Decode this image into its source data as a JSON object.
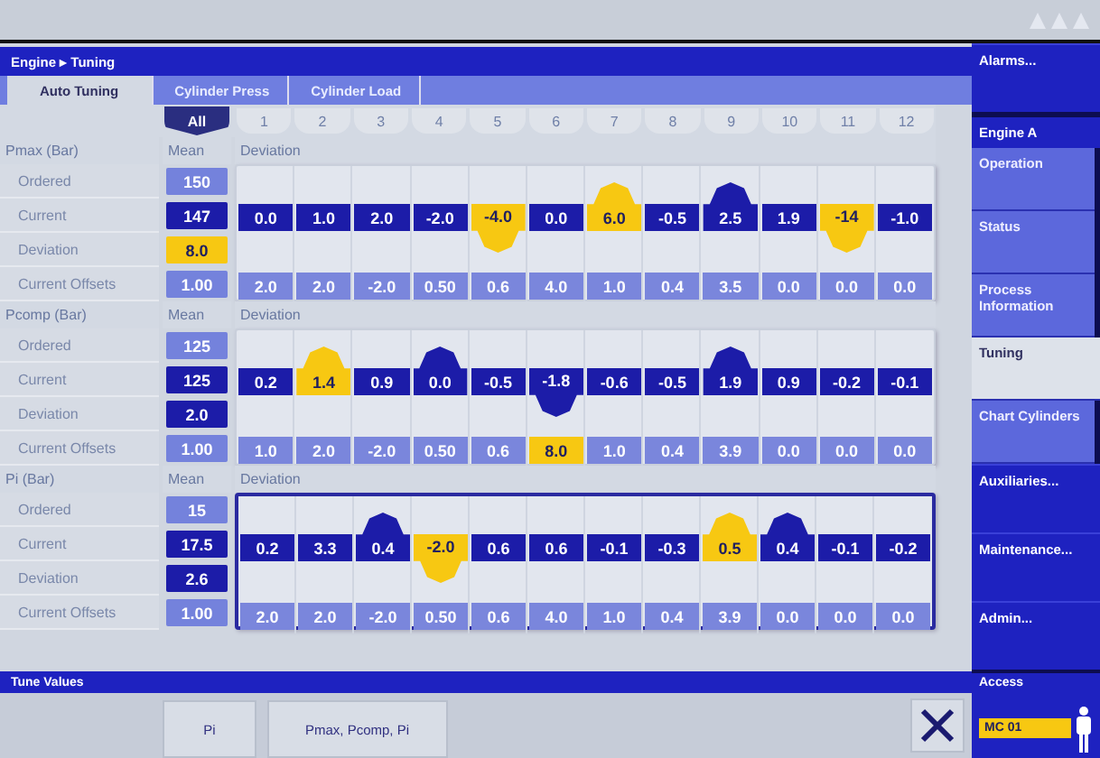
{
  "window": {
    "title": "Engine ▸ Tuning"
  },
  "tabs": [
    {
      "label": "Auto Tuning",
      "selected": true
    },
    {
      "label": "Cylinder Press",
      "selected": false
    },
    {
      "label": "Cylinder Load",
      "selected": false
    }
  ],
  "cylinders": [
    {
      "label": "All",
      "selected": true
    },
    {
      "label": "1",
      "selected": false
    },
    {
      "label": "2",
      "selected": false
    },
    {
      "label": "3",
      "selected": false
    },
    {
      "label": "4",
      "selected": false
    },
    {
      "label": "5",
      "selected": false
    },
    {
      "label": "6",
      "selected": false
    },
    {
      "label": "7",
      "selected": false
    },
    {
      "label": "8",
      "selected": false
    },
    {
      "label": "9",
      "selected": false
    },
    {
      "label": "10",
      "selected": false
    },
    {
      "label": "11",
      "selected": false
    },
    {
      "label": "12",
      "selected": false
    }
  ],
  "sections": [
    {
      "title": "Pmax (Bar)",
      "mean_heading": "Mean",
      "deviation_heading": "Deviation",
      "selected": false,
      "rows": [
        {
          "label": "Ordered",
          "kind": "ordered",
          "mean": "150",
          "warning": false
        },
        {
          "label": "Current",
          "kind": "current",
          "mean": "147",
          "warning": false
        },
        {
          "label": "Deviation",
          "kind": "deviation",
          "mean": "8.0",
          "warning": true
        },
        {
          "label": "Current Offsets",
          "kind": "offsets",
          "mean": "1.00",
          "warning": false
        }
      ],
      "current": [
        {
          "value": "0.0",
          "high": false,
          "low": false,
          "warning": false
        },
        {
          "value": "1.0",
          "high": false,
          "low": false,
          "warning": false
        },
        {
          "value": "2.0",
          "high": false,
          "low": false,
          "warning": false
        },
        {
          "value": "-2.0",
          "high": false,
          "low": false,
          "warning": false
        },
        {
          "value": "-4.0",
          "high": false,
          "low": true,
          "warning": true
        },
        {
          "value": "0.0",
          "high": false,
          "low": false,
          "warning": false
        },
        {
          "value": "6.0",
          "high": true,
          "low": false,
          "warning": true
        },
        {
          "value": "-0.5",
          "high": false,
          "low": false,
          "warning": false
        },
        {
          "value": "2.5",
          "high": true,
          "low": false,
          "warning": false
        },
        {
          "value": "1.9",
          "high": false,
          "low": false,
          "warning": false
        },
        {
          "value": "-14",
          "high": false,
          "low": true,
          "warning": true
        },
        {
          "value": "-1.0",
          "high": false,
          "low": false,
          "warning": false
        }
      ],
      "offsets": [
        {
          "value": "2.0",
          "warning": false
        },
        {
          "value": "2.0",
          "warning": false
        },
        {
          "value": "-2.0",
          "warning": false
        },
        {
          "value": "0.50",
          "warning": false
        },
        {
          "value": "0.6",
          "warning": false
        },
        {
          "value": "4.0",
          "warning": false
        },
        {
          "value": "1.0",
          "warning": false
        },
        {
          "value": "0.4",
          "warning": false
        },
        {
          "value": "3.5",
          "warning": false
        },
        {
          "value": "0.0",
          "warning": false
        },
        {
          "value": "0.0",
          "warning": false
        },
        {
          "value": "0.0",
          "warning": false
        }
      ]
    },
    {
      "title": "Pcomp (Bar)",
      "mean_heading": "Mean",
      "deviation_heading": "Deviation",
      "selected": false,
      "rows": [
        {
          "label": "Ordered",
          "kind": "ordered",
          "mean": "125",
          "warning": false
        },
        {
          "label": "Current",
          "kind": "current",
          "mean": "125",
          "warning": false
        },
        {
          "label": "Deviation",
          "kind": "deviation",
          "mean": "2.0",
          "warning": false
        },
        {
          "label": "Current Offsets",
          "kind": "offsets",
          "mean": "1.00",
          "warning": false
        }
      ],
      "current": [
        {
          "value": "0.2",
          "high": false,
          "low": false,
          "warning": false
        },
        {
          "value": "1.4",
          "high": true,
          "low": false,
          "warning": true
        },
        {
          "value": "0.9",
          "high": false,
          "low": false,
          "warning": false
        },
        {
          "value": "0.0",
          "high": true,
          "low": false,
          "warning": false
        },
        {
          "value": "-0.5",
          "high": false,
          "low": false,
          "warning": false
        },
        {
          "value": "-1.8",
          "high": false,
          "low": true,
          "warning": false
        },
        {
          "value": "-0.6",
          "high": false,
          "low": false,
          "warning": false
        },
        {
          "value": "-0.5",
          "high": false,
          "low": false,
          "warning": false
        },
        {
          "value": "1.9",
          "high": true,
          "low": false,
          "warning": false
        },
        {
          "value": "0.9",
          "high": false,
          "low": false,
          "warning": false
        },
        {
          "value": "-0.2",
          "high": false,
          "low": false,
          "warning": false
        },
        {
          "value": "-0.1",
          "high": false,
          "low": false,
          "warning": false
        }
      ],
      "offsets": [
        {
          "value": "1.0",
          "warning": false
        },
        {
          "value": "2.0",
          "warning": false
        },
        {
          "value": "-2.0",
          "warning": false
        },
        {
          "value": "0.50",
          "warning": false
        },
        {
          "value": "0.6",
          "warning": false
        },
        {
          "value": "8.0",
          "warning": true
        },
        {
          "value": "1.0",
          "warning": false
        },
        {
          "value": "0.4",
          "warning": false
        },
        {
          "value": "3.9",
          "warning": false
        },
        {
          "value": "0.0",
          "warning": false
        },
        {
          "value": "0.0",
          "warning": false
        },
        {
          "value": "0.0",
          "warning": false
        }
      ]
    },
    {
      "title": "Pi (Bar)",
      "mean_heading": "Mean",
      "deviation_heading": "Deviation",
      "selected": true,
      "rows": [
        {
          "label": "Ordered",
          "kind": "ordered",
          "mean": "15",
          "warning": false
        },
        {
          "label": "Current",
          "kind": "current",
          "mean": "17.5",
          "warning": false
        },
        {
          "label": "Deviation",
          "kind": "deviation",
          "mean": "2.6",
          "warning": false
        },
        {
          "label": "Current Offsets",
          "kind": "offsets",
          "mean": "1.00",
          "warning": false
        }
      ],
      "current": [
        {
          "value": "0.2",
          "high": false,
          "low": false,
          "warning": false
        },
        {
          "value": "3.3",
          "high": false,
          "low": false,
          "warning": false
        },
        {
          "value": "0.4",
          "high": true,
          "low": false,
          "warning": false
        },
        {
          "value": "-2.0",
          "high": false,
          "low": true,
          "warning": true
        },
        {
          "value": "0.6",
          "high": false,
          "low": false,
          "warning": false
        },
        {
          "value": "0.6",
          "high": false,
          "low": false,
          "warning": false
        },
        {
          "value": "-0.1",
          "high": false,
          "low": false,
          "warning": false
        },
        {
          "value": "-0.3",
          "high": false,
          "low": false,
          "warning": false
        },
        {
          "value": "0.5",
          "high": true,
          "low": false,
          "warning": true
        },
        {
          "value": "0.4",
          "high": true,
          "low": false,
          "warning": false
        },
        {
          "value": "-0.1",
          "high": false,
          "low": false,
          "warning": false
        },
        {
          "value": "-0.2",
          "high": false,
          "low": false,
          "warning": false
        }
      ],
      "offsets": [
        {
          "value": "2.0",
          "warning": false
        },
        {
          "value": "2.0",
          "warning": false
        },
        {
          "value": "-2.0",
          "warning": false
        },
        {
          "value": "0.50",
          "warning": false
        },
        {
          "value": "0.6",
          "warning": false
        },
        {
          "value": "4.0",
          "warning": false
        },
        {
          "value": "1.0",
          "warning": false
        },
        {
          "value": "0.4",
          "warning": false
        },
        {
          "value": "3.9",
          "warning": false
        },
        {
          "value": "0.0",
          "warning": false
        },
        {
          "value": "0.0",
          "warning": false
        },
        {
          "value": "0.0",
          "warning": false
        }
      ]
    }
  ],
  "footer": {
    "title": "Tune Values",
    "buttons": [
      "Pi",
      "Pmax, Pcomp, Pi"
    ]
  },
  "sidebar": {
    "items": [
      {
        "label": "Alarms...",
        "kind": "link",
        "selected": false
      },
      {
        "label": "Engine A",
        "kind": "header",
        "selected": false
      },
      {
        "label": "Operation",
        "kind": "sub",
        "selected": false
      },
      {
        "label": "Status",
        "kind": "sub",
        "selected": false
      },
      {
        "label": "Process Information",
        "kind": "sub",
        "selected": false
      },
      {
        "label": "Tuning",
        "kind": "sub",
        "selected": true
      },
      {
        "label": "Chart Cylinders",
        "kind": "sub",
        "selected": false
      },
      {
        "label": "Auxiliaries...",
        "kind": "link",
        "selected": false
      },
      {
        "label": "Maintenance...",
        "kind": "link",
        "selected": false
      },
      {
        "label": "Admin...",
        "kind": "link",
        "selected": false
      }
    ],
    "access": {
      "label": "Access",
      "badge": "MC 01"
    }
  }
}
